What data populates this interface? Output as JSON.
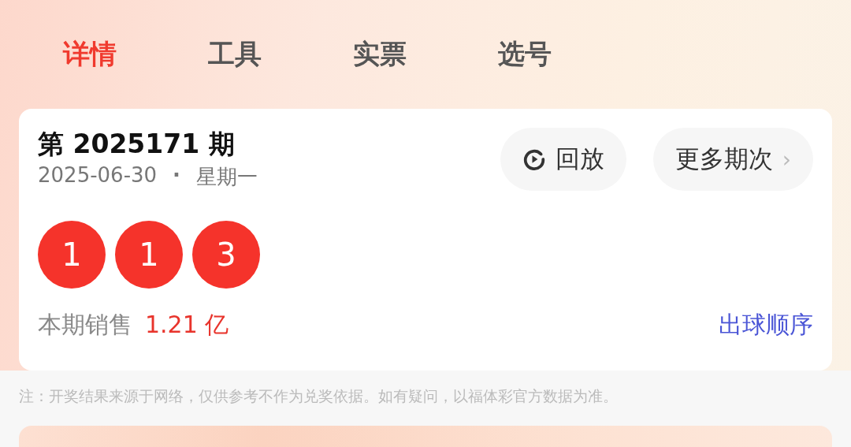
{
  "tabs": [
    {
      "label": "详情",
      "selected": true
    },
    {
      "label": "工具",
      "selected": false
    },
    {
      "label": "实票",
      "selected": false
    },
    {
      "label": "选号",
      "selected": false
    }
  ],
  "draw": {
    "issue": "第 2025171 期",
    "date": "2025-06-30",
    "separator": "·",
    "weekday": "星期一",
    "buttons": [
      {
        "kind": "replay",
        "label": "回放"
      },
      {
        "kind": "more",
        "label": "更多期次",
        "chevron": "›"
      }
    ],
    "balls": [
      "1",
      "1",
      "3"
    ],
    "sales_label": "本期销售",
    "sales_value": "1.21 亿",
    "order_link": "出球顺序"
  },
  "note": "注：开奖结果来源于网络，仅供参考不作为兑奖依据。如有疑问，以福体彩官方数据为准。"
}
